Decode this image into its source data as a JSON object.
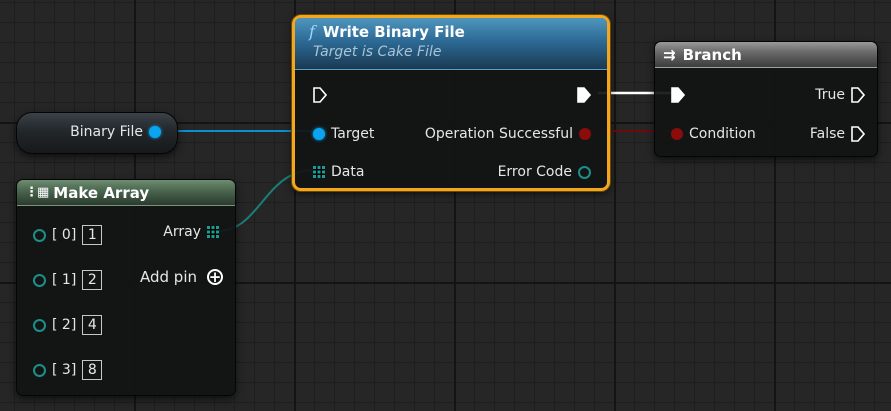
{
  "variable_node": {
    "label": "Binary File"
  },
  "write_node": {
    "title": "Write Binary File",
    "subtitle": "Target is Cake File",
    "function_icon": "f",
    "inputs": {
      "target": "Target",
      "data": "Data"
    },
    "outputs": {
      "operation": "Operation Successful",
      "error": "Error Code"
    }
  },
  "branch_node": {
    "title": "Branch",
    "inputs": {
      "condition": "Condition"
    },
    "outputs": {
      "true": "True",
      "false": "False"
    }
  },
  "array_node": {
    "title": "Make Array",
    "output": "Array",
    "add_pin": "Add pin",
    "items": [
      {
        "index": "[ 0]",
        "value": "1"
      },
      {
        "index": "[ 1]",
        "value": "2"
      },
      {
        "index": "[ 2]",
        "value": "4"
      },
      {
        "index": "[ 3]",
        "value": "8"
      }
    ]
  },
  "colors": {
    "object_pin": "#0aa5f0",
    "bool_pin": "#8c0c0c",
    "byte_pin": "#1c8f8a",
    "selection": "#f3a71e",
    "exec": "#ffffff"
  }
}
